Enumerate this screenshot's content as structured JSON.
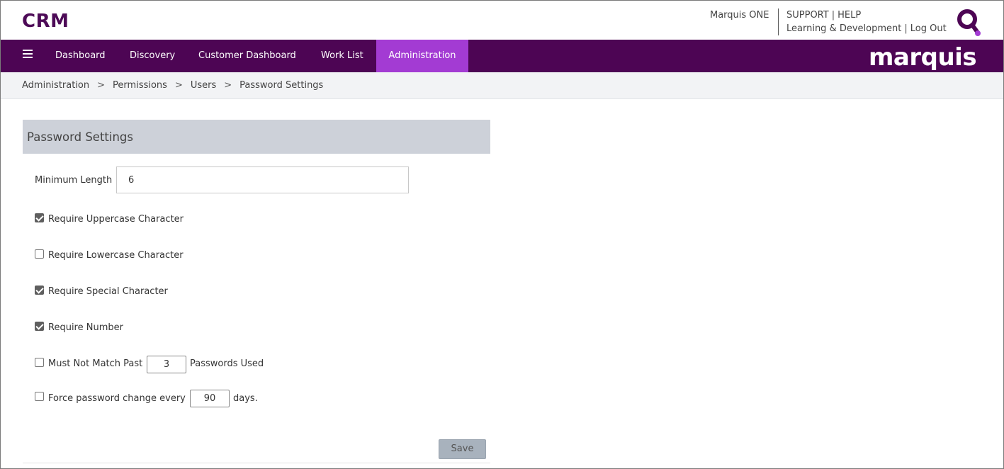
{
  "header": {
    "app_title": "CRM",
    "marquis_one": "Marquis ONE",
    "support": "SUPPORT",
    "help": "HELP",
    "learning": "Learning & Development",
    "logout": "Log Out",
    "search_logo_icon": "q-search-logo-icon"
  },
  "nav": {
    "items": [
      {
        "label": "Dashboard"
      },
      {
        "label": "Discovery"
      },
      {
        "label": "Customer Dashboard"
      },
      {
        "label": "Work List"
      },
      {
        "label": "Administration",
        "active": true
      }
    ],
    "brand": "marquis",
    "colors": {
      "bar": "#4d0554",
      "active": "#a33bd3"
    }
  },
  "breadcrumb": [
    "Administration",
    "Permissions",
    "Users",
    "Password Settings"
  ],
  "breadcrumb_separator": ">",
  "panel": {
    "title": "Password Settings",
    "min_length_label": "Minimum Length",
    "min_length_value": "6",
    "require_uppercase": {
      "label": "Require Uppercase Character",
      "checked": true
    },
    "require_lowercase": {
      "label": "Require Lowercase Character",
      "checked": false
    },
    "require_special": {
      "label": "Require Special Character",
      "checked": true
    },
    "require_number": {
      "label": "Require Number",
      "checked": true
    },
    "past_passwords": {
      "label_before": "Must Not Match Past",
      "value": "3",
      "label_after": "Passwords Used",
      "checked": false
    },
    "force_change": {
      "label_before": "Force password change every",
      "value": "90",
      "label_after": "days.",
      "checked": false
    },
    "save_label": "Save"
  }
}
